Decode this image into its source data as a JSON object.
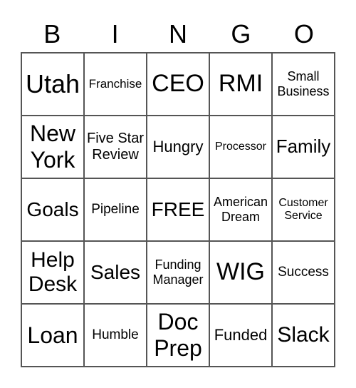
{
  "header": [
    "B",
    "I",
    "N",
    "G",
    "O"
  ],
  "cells": [
    [
      "Utah",
      "Franchise",
      "CEO",
      "RMI",
      "Small Business"
    ],
    [
      "New York",
      "Five Star Review",
      "Hungry",
      "Processor",
      "Family"
    ],
    [
      "Goals",
      "Pipeline",
      "FREE",
      "American Dream",
      "Customer Service"
    ],
    [
      "Help Desk",
      "Sales",
      "Funding Manager",
      "WIG",
      "Success"
    ],
    [
      "Loan",
      "Humble",
      "Doc Prep",
      "Funded",
      "Slack"
    ]
  ]
}
